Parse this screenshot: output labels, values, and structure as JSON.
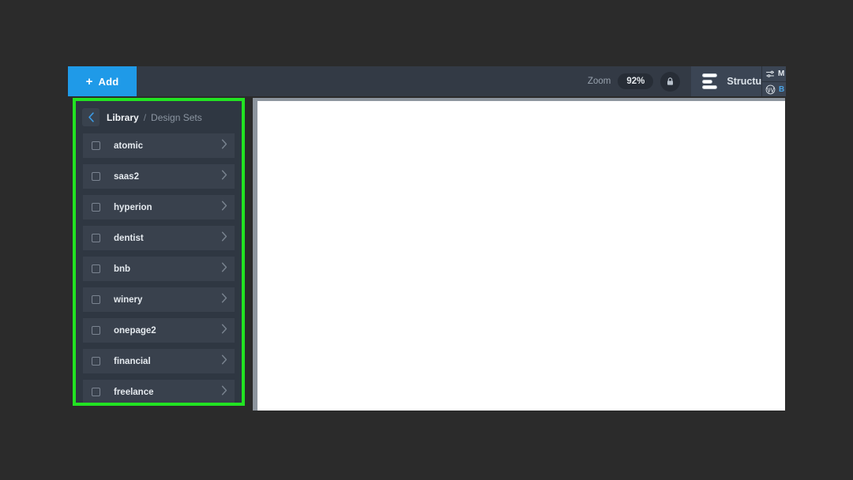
{
  "toolbar": {
    "add_label": "Add",
    "add_icon": "plus-icon",
    "zoom_label": "Zoom",
    "zoom_value": "92%",
    "lock_icon": "lock-icon",
    "structure_label": "Structure",
    "structure_icon": "stacked-bars-icon",
    "accent_color": "#1f9ae8",
    "background_color": "#333a45"
  },
  "right_panel": {
    "rows": [
      {
        "icon": "sliders-icon",
        "label": "M"
      },
      {
        "icon": "wordpress-icon",
        "label": "B"
      }
    ]
  },
  "library": {
    "back_icon": "chevron-left-icon",
    "breadcrumb": {
      "current": "Library",
      "separator": "/",
      "sub": "Design Sets"
    },
    "highlight_color": "#22e322",
    "items": [
      {
        "label": "atomic",
        "checked": false,
        "chevron": "chevron-right-icon"
      },
      {
        "label": "saas2",
        "checked": false,
        "chevron": "chevron-right-icon"
      },
      {
        "label": "hyperion",
        "checked": false,
        "chevron": "chevron-right-icon"
      },
      {
        "label": "dentist",
        "checked": false,
        "chevron": "chevron-right-icon"
      },
      {
        "label": "bnb",
        "checked": false,
        "chevron": "chevron-right-icon"
      },
      {
        "label": "winery",
        "checked": false,
        "chevron": "chevron-right-icon"
      },
      {
        "label": "onepage2",
        "checked": false,
        "chevron": "chevron-right-icon"
      },
      {
        "label": "financial",
        "checked": false,
        "chevron": "chevron-right-icon"
      },
      {
        "label": "freelance",
        "checked": false,
        "chevron": "chevron-right-icon"
      }
    ]
  },
  "canvas": {
    "page_color": "#ffffff",
    "frame_color": "#8d959e"
  }
}
